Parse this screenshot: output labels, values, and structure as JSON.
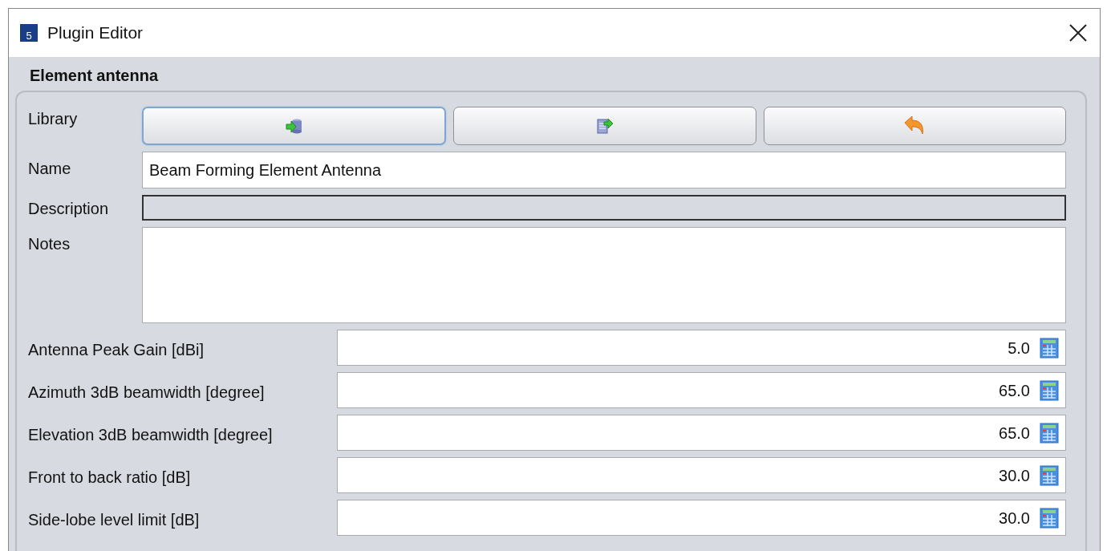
{
  "window": {
    "title": "Plugin Editor",
    "app_icon_text": "5"
  },
  "section_title": "Element antenna",
  "library": {
    "label": "Library",
    "buttons": [
      {
        "kind": "import",
        "focused": true
      },
      {
        "kind": "export",
        "focused": false
      },
      {
        "kind": "undo",
        "focused": false
      }
    ]
  },
  "fields": [
    {
      "label": "Name",
      "value": "Beam Forming Element Antenna",
      "kind": "text",
      "disabled": false
    },
    {
      "label": "Description",
      "kind": "text",
      "disabled": true
    },
    {
      "label": "Notes",
      "kind": "area",
      "disabled": false
    }
  ],
  "parameters": [
    {
      "label": "Antenna Peak Gain [dBi]",
      "value": "5.0"
    },
    {
      "label": "Azimuth 3dB beamwidth [degree]",
      "value": "65.0"
    },
    {
      "label": "Elevation 3dB beamwidth [degree]",
      "value": "65.0"
    },
    {
      "label": "Front to back ratio [dB]",
      "value": "30.0"
    },
    {
      "label": "Side-lobe level limit [dB]",
      "value": "30.0"
    }
  ]
}
